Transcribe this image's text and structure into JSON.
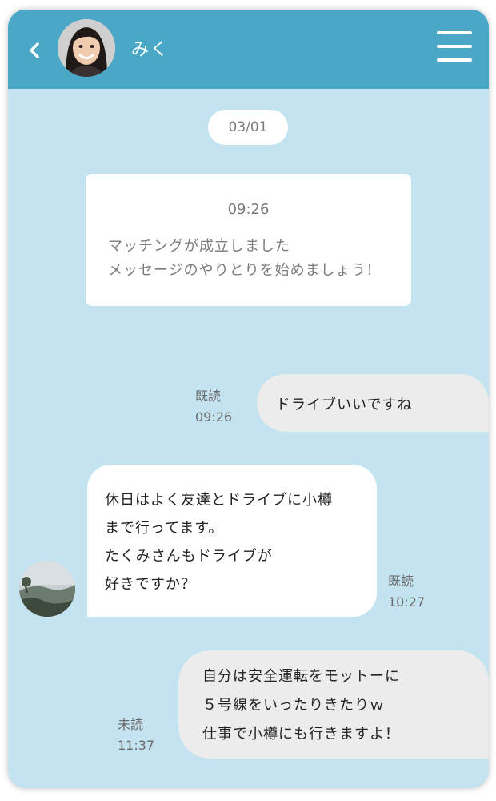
{
  "header": {
    "contact_name": "みく",
    "back_icon": "chevron-left-icon",
    "menu_icon": "hamburger-menu-icon",
    "color": "#4aa8c6"
  },
  "date_label": "03/01",
  "system_message": {
    "time": "09:26",
    "lines": [
      "マッチングが成立しました",
      "メッセージのやりとりを始めましょう！"
    ]
  },
  "messages": [
    {
      "direction": "outgoing",
      "lines": [
        "ドライブいいですね"
      ],
      "status": "既読",
      "time": "09:26"
    },
    {
      "direction": "incoming",
      "lines": [
        "休日はよく友達とドライブに小樽",
        "まで行ってます。",
        "たくみさんもドライブが",
        "好きですか？"
      ],
      "status": "既読",
      "time": "10:27"
    },
    {
      "direction": "outgoing",
      "lines": [
        "自分は安全運転をモットーに",
        "５号線をいったりきたりｗ",
        "仕事で小樽にも行きますよ！"
      ],
      "status": "未読",
      "time": "11:37"
    }
  ],
  "colors": {
    "chat_background": "#c4e3f0",
    "outgoing_bubble": "#ececec",
    "incoming_bubble": "#ffffff"
  }
}
